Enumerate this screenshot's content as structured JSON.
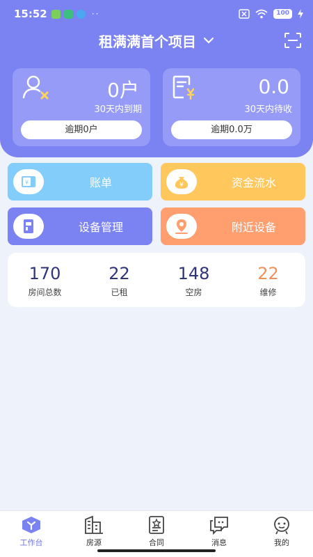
{
  "status_bar": {
    "time": "15:52",
    "battery": "100",
    "dots": "··"
  },
  "header": {
    "project_title": "租满满首个项目"
  },
  "cards": [
    {
      "value": "0户",
      "subtitle": "30天内到期",
      "button": "逾期0户"
    },
    {
      "value": "0.0",
      "subtitle": "30天内待收",
      "button": "逾期0.0万"
    }
  ],
  "tiles": [
    {
      "label": "账单",
      "color": "#82cdfa"
    },
    {
      "label": "资金流水",
      "color": "#ffc75c"
    },
    {
      "label": "设备管理",
      "color": "#7b82f1"
    },
    {
      "label": "附近设备",
      "color": "#ff9e6e"
    }
  ],
  "counts": [
    {
      "value": "170",
      "label": "房间总数",
      "color": "#2f3577"
    },
    {
      "value": "22",
      "label": "已租",
      "color": "#2f3577"
    },
    {
      "value": "148",
      "label": "空房",
      "color": "#2f3577"
    },
    {
      "value": "22",
      "label": "维修",
      "color": "#f0905a"
    }
  ],
  "tabbar": [
    {
      "label": "工作台",
      "active": true
    },
    {
      "label": "房源",
      "active": false
    },
    {
      "label": "合同",
      "active": false
    },
    {
      "label": "消息",
      "active": false
    },
    {
      "label": "我的",
      "active": false
    }
  ],
  "colors": {
    "primary": "#7b82f1",
    "card": "#959bf6",
    "background": "#eef2fb"
  }
}
